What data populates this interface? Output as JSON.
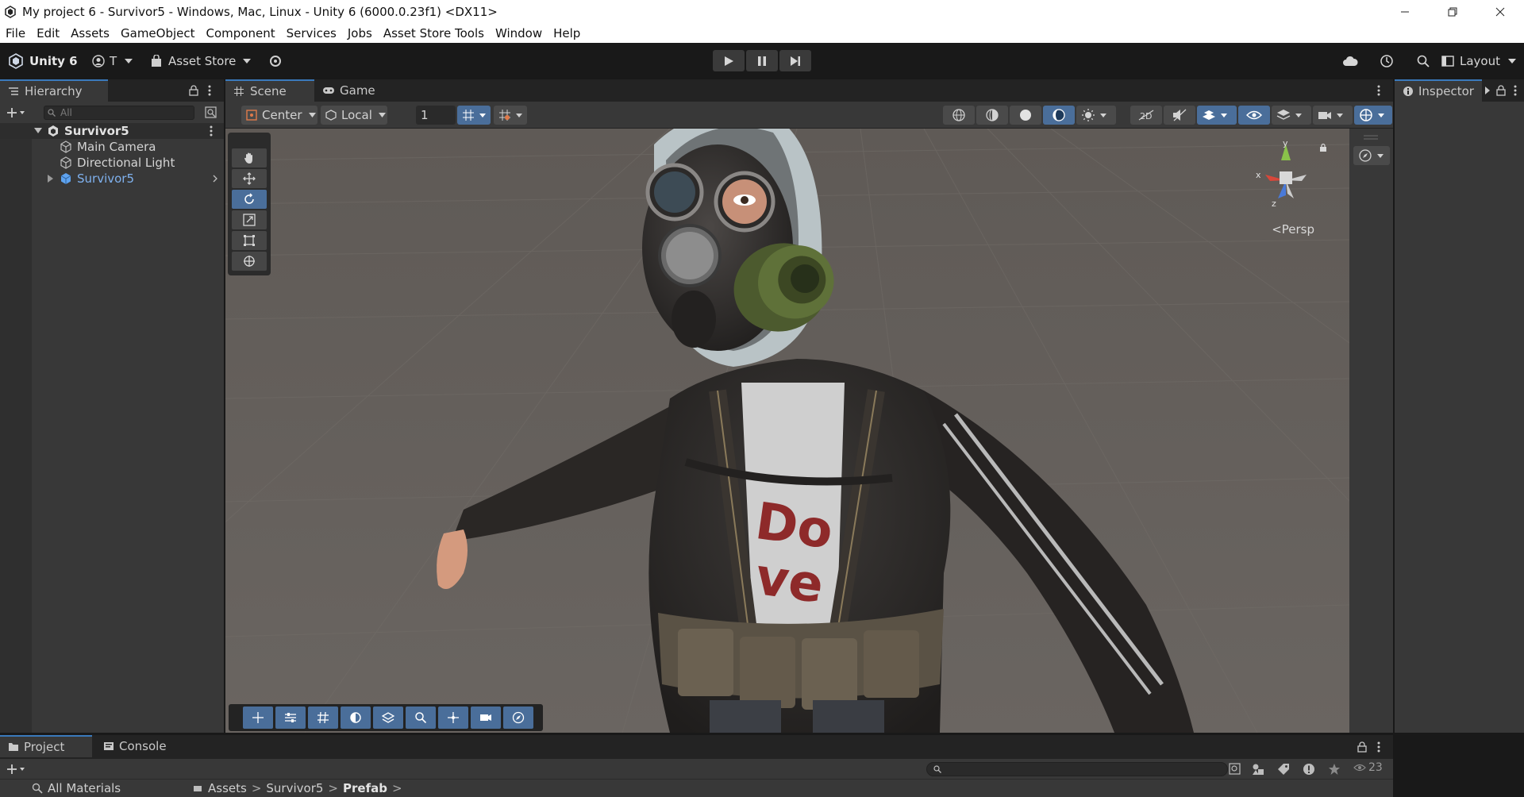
{
  "window": {
    "title": "My project 6 - Survivor5 - Windows, Mac, Linux - Unity 6 (6000.0.23f1) <DX11>",
    "minimize_icon": "minimize-icon",
    "restore_icon": "restore-icon",
    "close_icon": "close-icon"
  },
  "menu": [
    "File",
    "Edit",
    "Assets",
    "GameObject",
    "Component",
    "Services",
    "Jobs",
    "Asset Store Tools",
    "Window",
    "Help"
  ],
  "toolbar": {
    "unity_label": "Unity 6",
    "account_label": "T",
    "asset_store_label": "Asset Store",
    "layout_label": "Layout"
  },
  "hierarchy": {
    "tab_label": "Hierarchy",
    "search_placeholder": "All",
    "scene_name": "Survivor5",
    "items": [
      {
        "label": "Main Camera",
        "icon": "gameobject-icon"
      },
      {
        "label": "Directional Light",
        "icon": "gameobject-icon"
      },
      {
        "label": "Survivor5",
        "icon": "prefab-icon",
        "color": "#7fb1ee"
      }
    ]
  },
  "scene": {
    "tab_scene": "Scene",
    "tab_game": "Game",
    "pivot_mode": "Center",
    "pivot_rotation": "Local",
    "grid_size": "1",
    "persp_label": "<Persp",
    "gizmo_axes": {
      "x": "x",
      "y": "y",
      "z": "z"
    }
  },
  "inspector": {
    "tab_label": "Inspector"
  },
  "project": {
    "tab_project": "Project",
    "tab_console": "Console",
    "favorites_label": "All Materials",
    "breadcrumb": [
      "Assets",
      "Survivor5",
      "Prefab"
    ],
    "hidden_count": "23"
  },
  "colors": {
    "accent_blue": "#3a79bb",
    "button_blue": "#4a6e9a",
    "panel_bg": "#383838",
    "toolbar_bg": "#191919"
  }
}
